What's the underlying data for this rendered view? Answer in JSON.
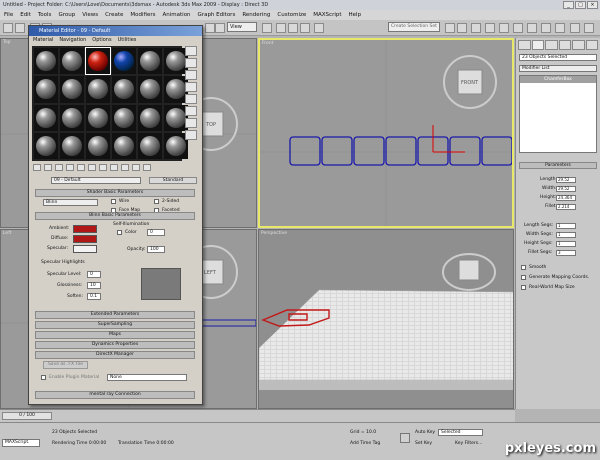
{
  "window": {
    "title": "Untitled    - Project Folder: C:\\Users\\Love\\Documents\\3dsmax    - Autodesk 3ds Max 2009    - Display : Direct 3D",
    "buttons": [
      "_",
      "□",
      "×"
    ]
  },
  "menu": [
    "File",
    "Edit",
    "Tools",
    "Group",
    "Views",
    "Create",
    "Modifiers",
    "Animation",
    "Graph Editors",
    "Rendering",
    "Customize",
    "MAXScript",
    "Help"
  ],
  "toolbar": {
    "view_select": "View",
    "selection_set": "Create Selection Set"
  },
  "viewports": {
    "top": "Top",
    "front": "Front",
    "left": "Left",
    "perspective": "Perspective",
    "cube_top": "TOP",
    "cube_front": "FRONT",
    "cube_left": "LEFT"
  },
  "material_editor": {
    "title": "Material Editor - 09 - Default",
    "menu": [
      "Material",
      "Navigation",
      "Options",
      "Utilities"
    ],
    "material_name": "09 - Default",
    "material_type": "Standard",
    "shader_rollout": "Shader Basic Parameters",
    "shader": "Blinn",
    "wire": "Wire",
    "two_sided": "2-Sided",
    "face_map": "Face Map",
    "faceted": "Faceted",
    "blinn_rollout": "Blinn Basic Parameters",
    "self_illum": "Self-Illumination",
    "color_label": "Color",
    "color_value": "0",
    "ambient": "Ambient:",
    "diffuse": "Diffuse:",
    "specular": "Specular:",
    "opacity_label": "Opacity:",
    "opacity_value": "100",
    "spec_highlights": "Specular Highlights",
    "spec_level_label": "Specular Level:",
    "spec_level": "0",
    "gloss_label": "Glossiness:",
    "gloss": "10",
    "soften_label": "Soften:",
    "soften": "0.1",
    "rollouts": [
      "Extended Parameters",
      "SuperSampling",
      "Maps",
      "Dynamics Properties",
      "DirectX Manager"
    ],
    "save_fx": "Save as .FX File",
    "enable_plugin": "Enable Plugin Material",
    "plugin_value": "None",
    "mentalray": "mental ray Connection",
    "ambient_color": "#b01818",
    "diffuse_color": "#b01818"
  },
  "command_panel": {
    "selection": "23 Objects Selected",
    "modifier_list": "Modifier List",
    "stack_item": "ChamferBox",
    "params_title": "Parameters",
    "length_label": "Length:",
    "length": "29.52",
    "width_label": "Width:",
    "width": "29.52",
    "height_label": "Height:",
    "height": "24.364",
    "fillet_label": "Fillet:",
    "fillet": "2.214",
    "lsegs_label": "Length Segs:",
    "lsegs": "1",
    "wsegs_label": "Width Segs:",
    "wsegs": "1",
    "hsegs_label": "Height Segs:",
    "hsegs": "1",
    "fsegs_label": "Fillet Segs:",
    "fsegs": "3",
    "smooth": "Smooth",
    "gen_mapping": "Generate Mapping Coords.",
    "real_world": "Real-World Map Size"
  },
  "timeline": {
    "frame": "0 / 100"
  },
  "status": {
    "objects": "23 Objects Selected",
    "prompt": "Rendering Time  0:00:00",
    "translation": "Translation Time  0:00:00",
    "grid": "Grid = 10.0",
    "auto_key": "Auto Key",
    "set_key": "Set Key",
    "selected": "Selected",
    "key_filters": "Key Filters...",
    "add_time_tag": "Add Time Tag",
    "maxscript": "MAXScript."
  },
  "watermark": "pxleyes.com"
}
